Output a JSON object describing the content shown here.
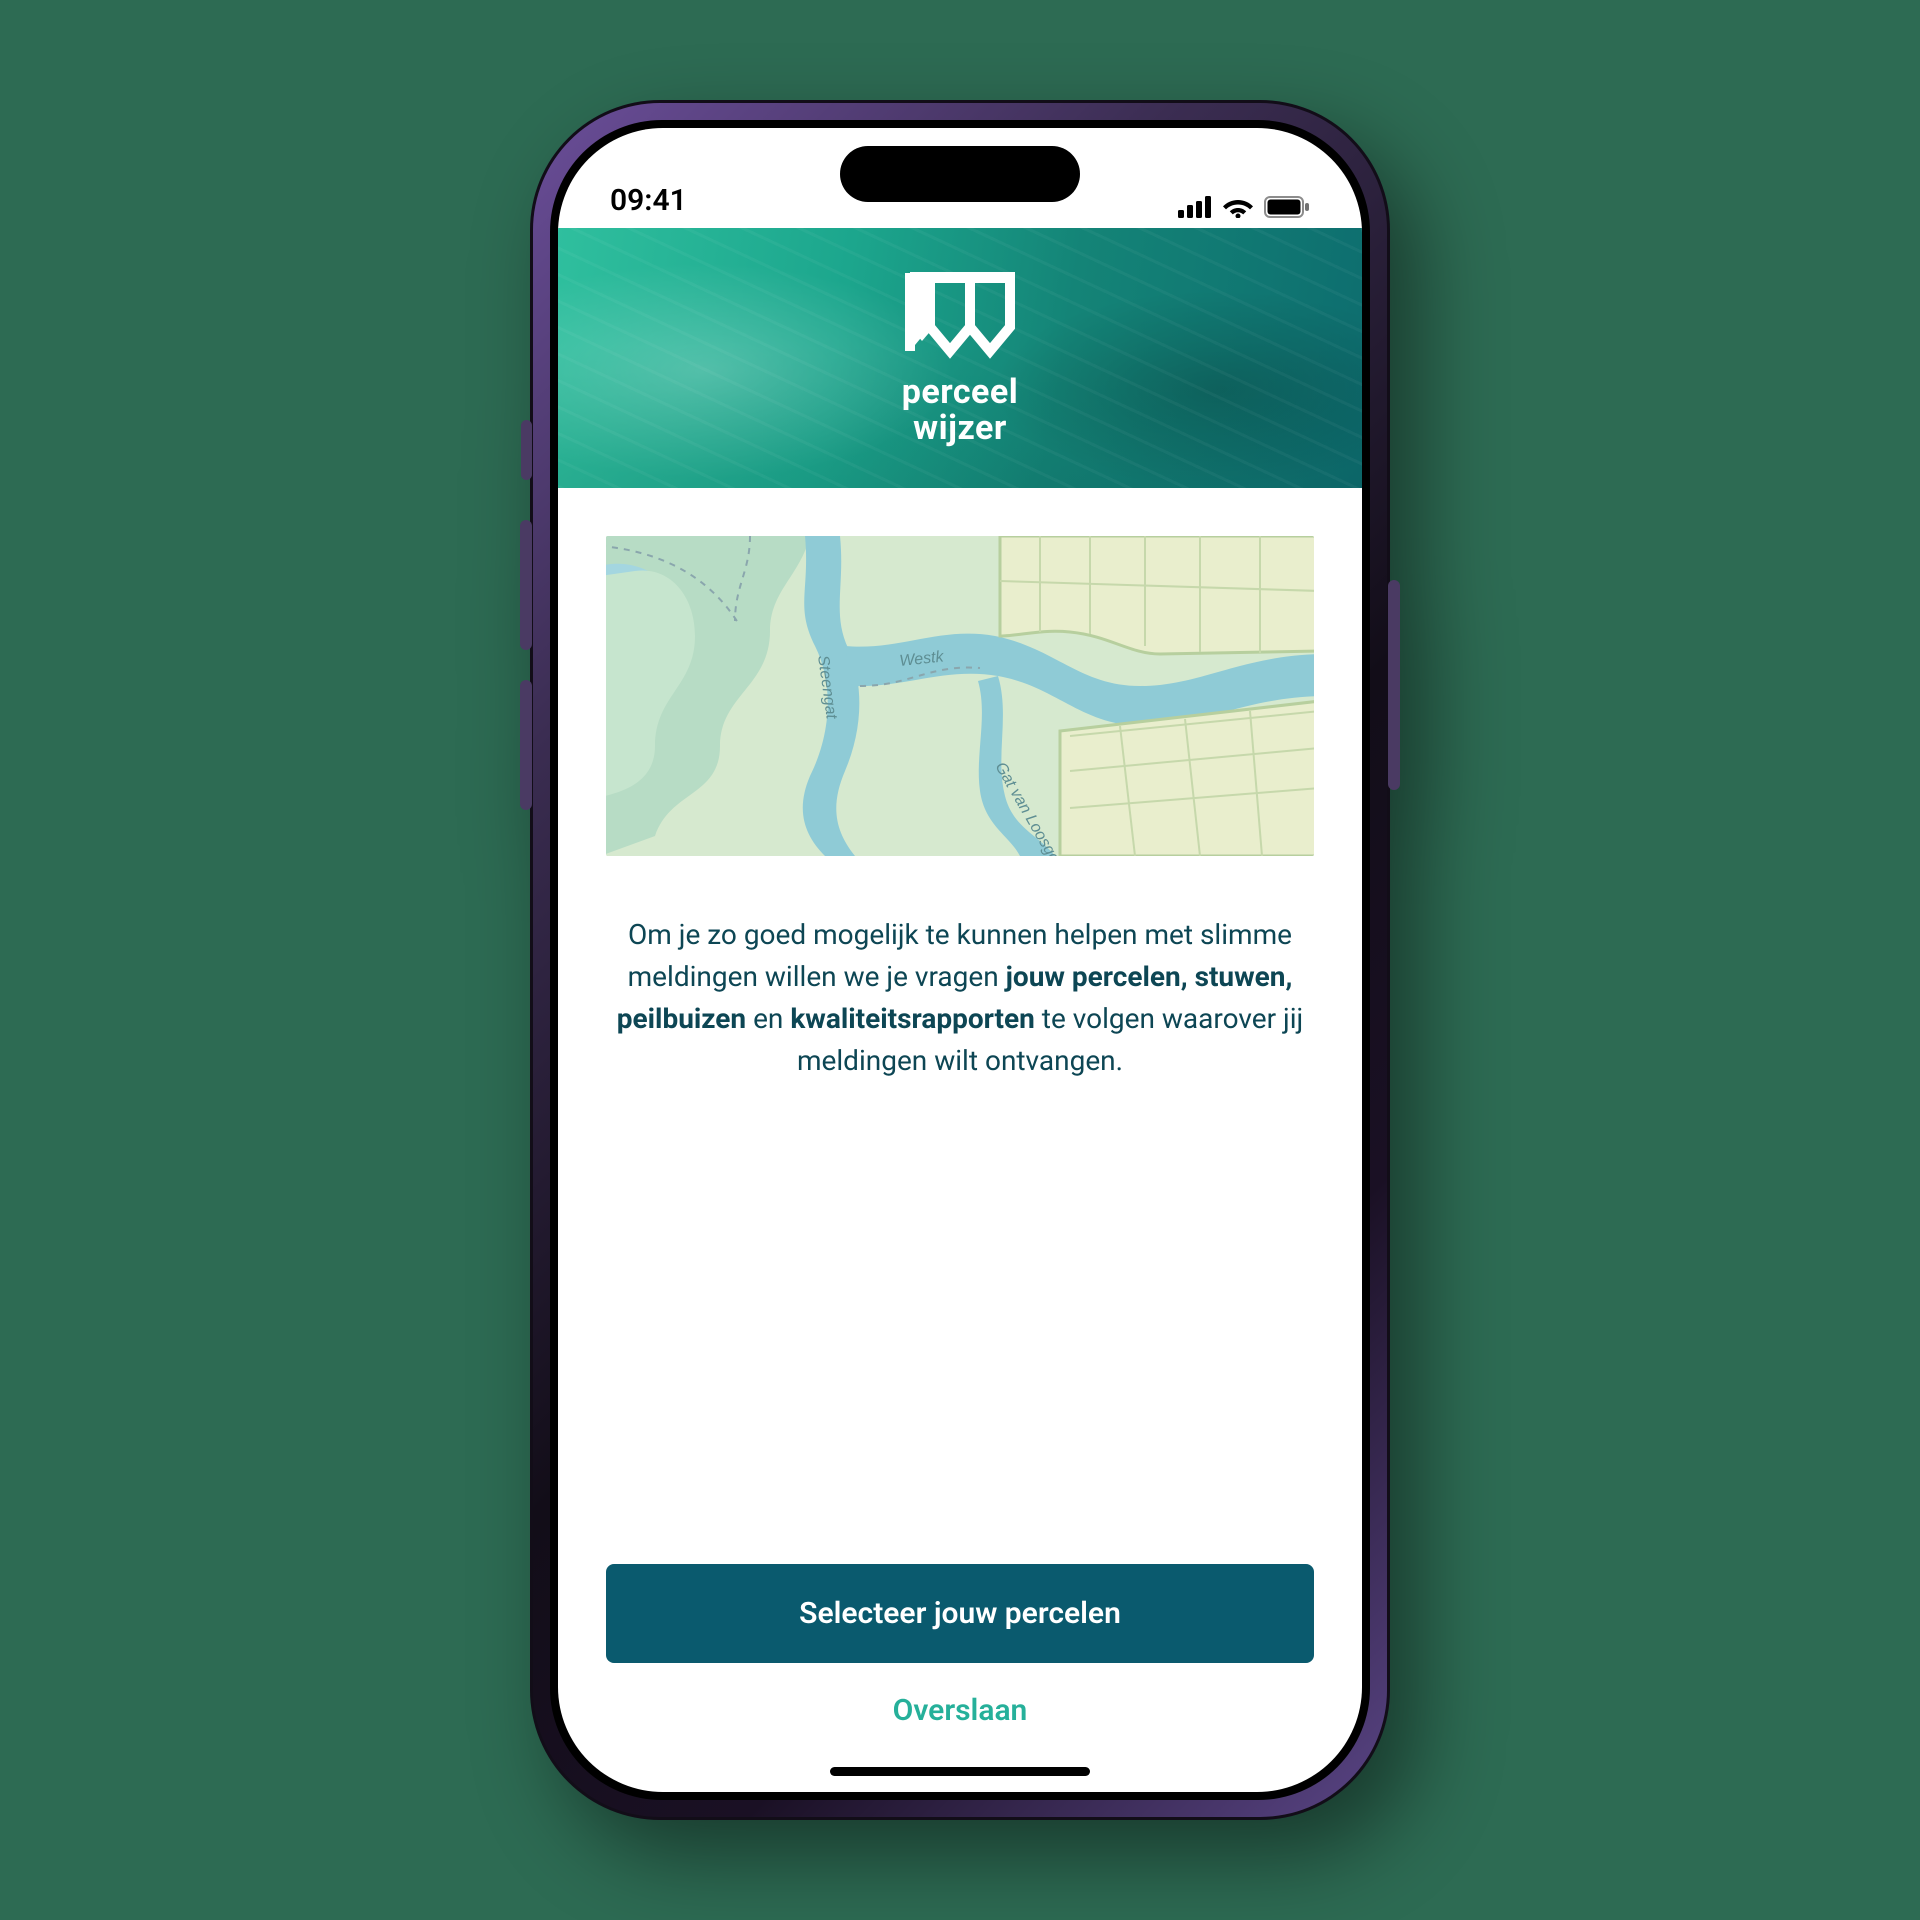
{
  "status_bar": {
    "time": "09:41"
  },
  "header": {
    "logo_line1": "perceel",
    "logo_line2": "wijzer"
  },
  "intro": {
    "part1": "Om je zo goed mogelijk te kunnen helpen met slimme meldingen willen we je vragen ",
    "bold1": "jouw percelen, stuwen, peilbuizen",
    "part2": " en ",
    "bold2": "kwaliteitsrapporten",
    "part3": " te volgen waarover jij meldingen wilt ontvangen."
  },
  "buttons": {
    "primary": "Selecteer jouw percelen",
    "skip": "Overslaan"
  }
}
